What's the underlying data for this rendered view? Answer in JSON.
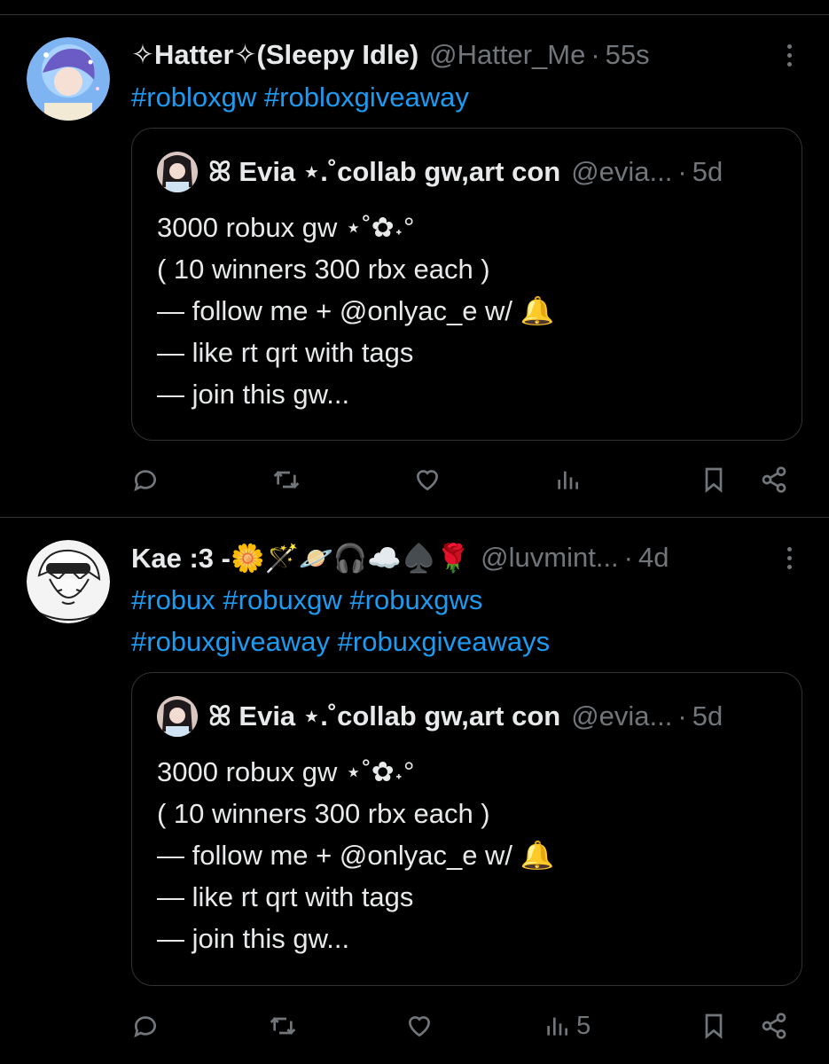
{
  "tweets": [
    {
      "name": "✧Hatter✧(Sleepy Idle)",
      "handle": "@Hatter_Me",
      "sep": "·",
      "time": "55s",
      "hashtags": [
        "#robloxgw #robloxgiveaway"
      ],
      "quote": {
        "name": "ꕤ Evia ⋆.˚collab gw,art con",
        "handle": "@evia...",
        "sep": "·",
        "time": "5d",
        "text": "3000 robux gw ⋆˚✿˖°\n( 10 winners 300 rbx each )\n— follow me + @onlyac_e w/ 🔔\n— like rt qrt with tags\n— join this gw..."
      },
      "views": ""
    },
    {
      "name": "Kae :3 -🌼🪄🪐🎧☁️♠️🌹",
      "handle": "@luvmint...",
      "sep": "·",
      "time": "4d",
      "hashtags": [
        "#robux #robuxgw #robuxgws",
        "#robuxgiveaway #robuxgiveaways"
      ],
      "quote": {
        "name": "ꕤ Evia ⋆.˚collab gw,art con",
        "handle": "@evia...",
        "sep": "·",
        "time": "5d",
        "text": "3000 robux gw ⋆˚✿˖°\n( 10 winners 300 rbx each )\n— follow me + @onlyac_e w/ 🔔\n— like rt qrt with tags\n— join this gw..."
      },
      "views": "5"
    }
  ],
  "icons": {
    "reply": "reply-icon",
    "retweet": "retweet-icon",
    "like": "heart-icon",
    "views": "views-icon",
    "bookmark": "bookmark-icon",
    "share": "share-icon",
    "more": "more-icon"
  },
  "colors": {
    "background": "#000000",
    "text": "#e7e9ea",
    "muted": "#71767b",
    "link": "#1d9bf0",
    "border": "#2f3336"
  }
}
